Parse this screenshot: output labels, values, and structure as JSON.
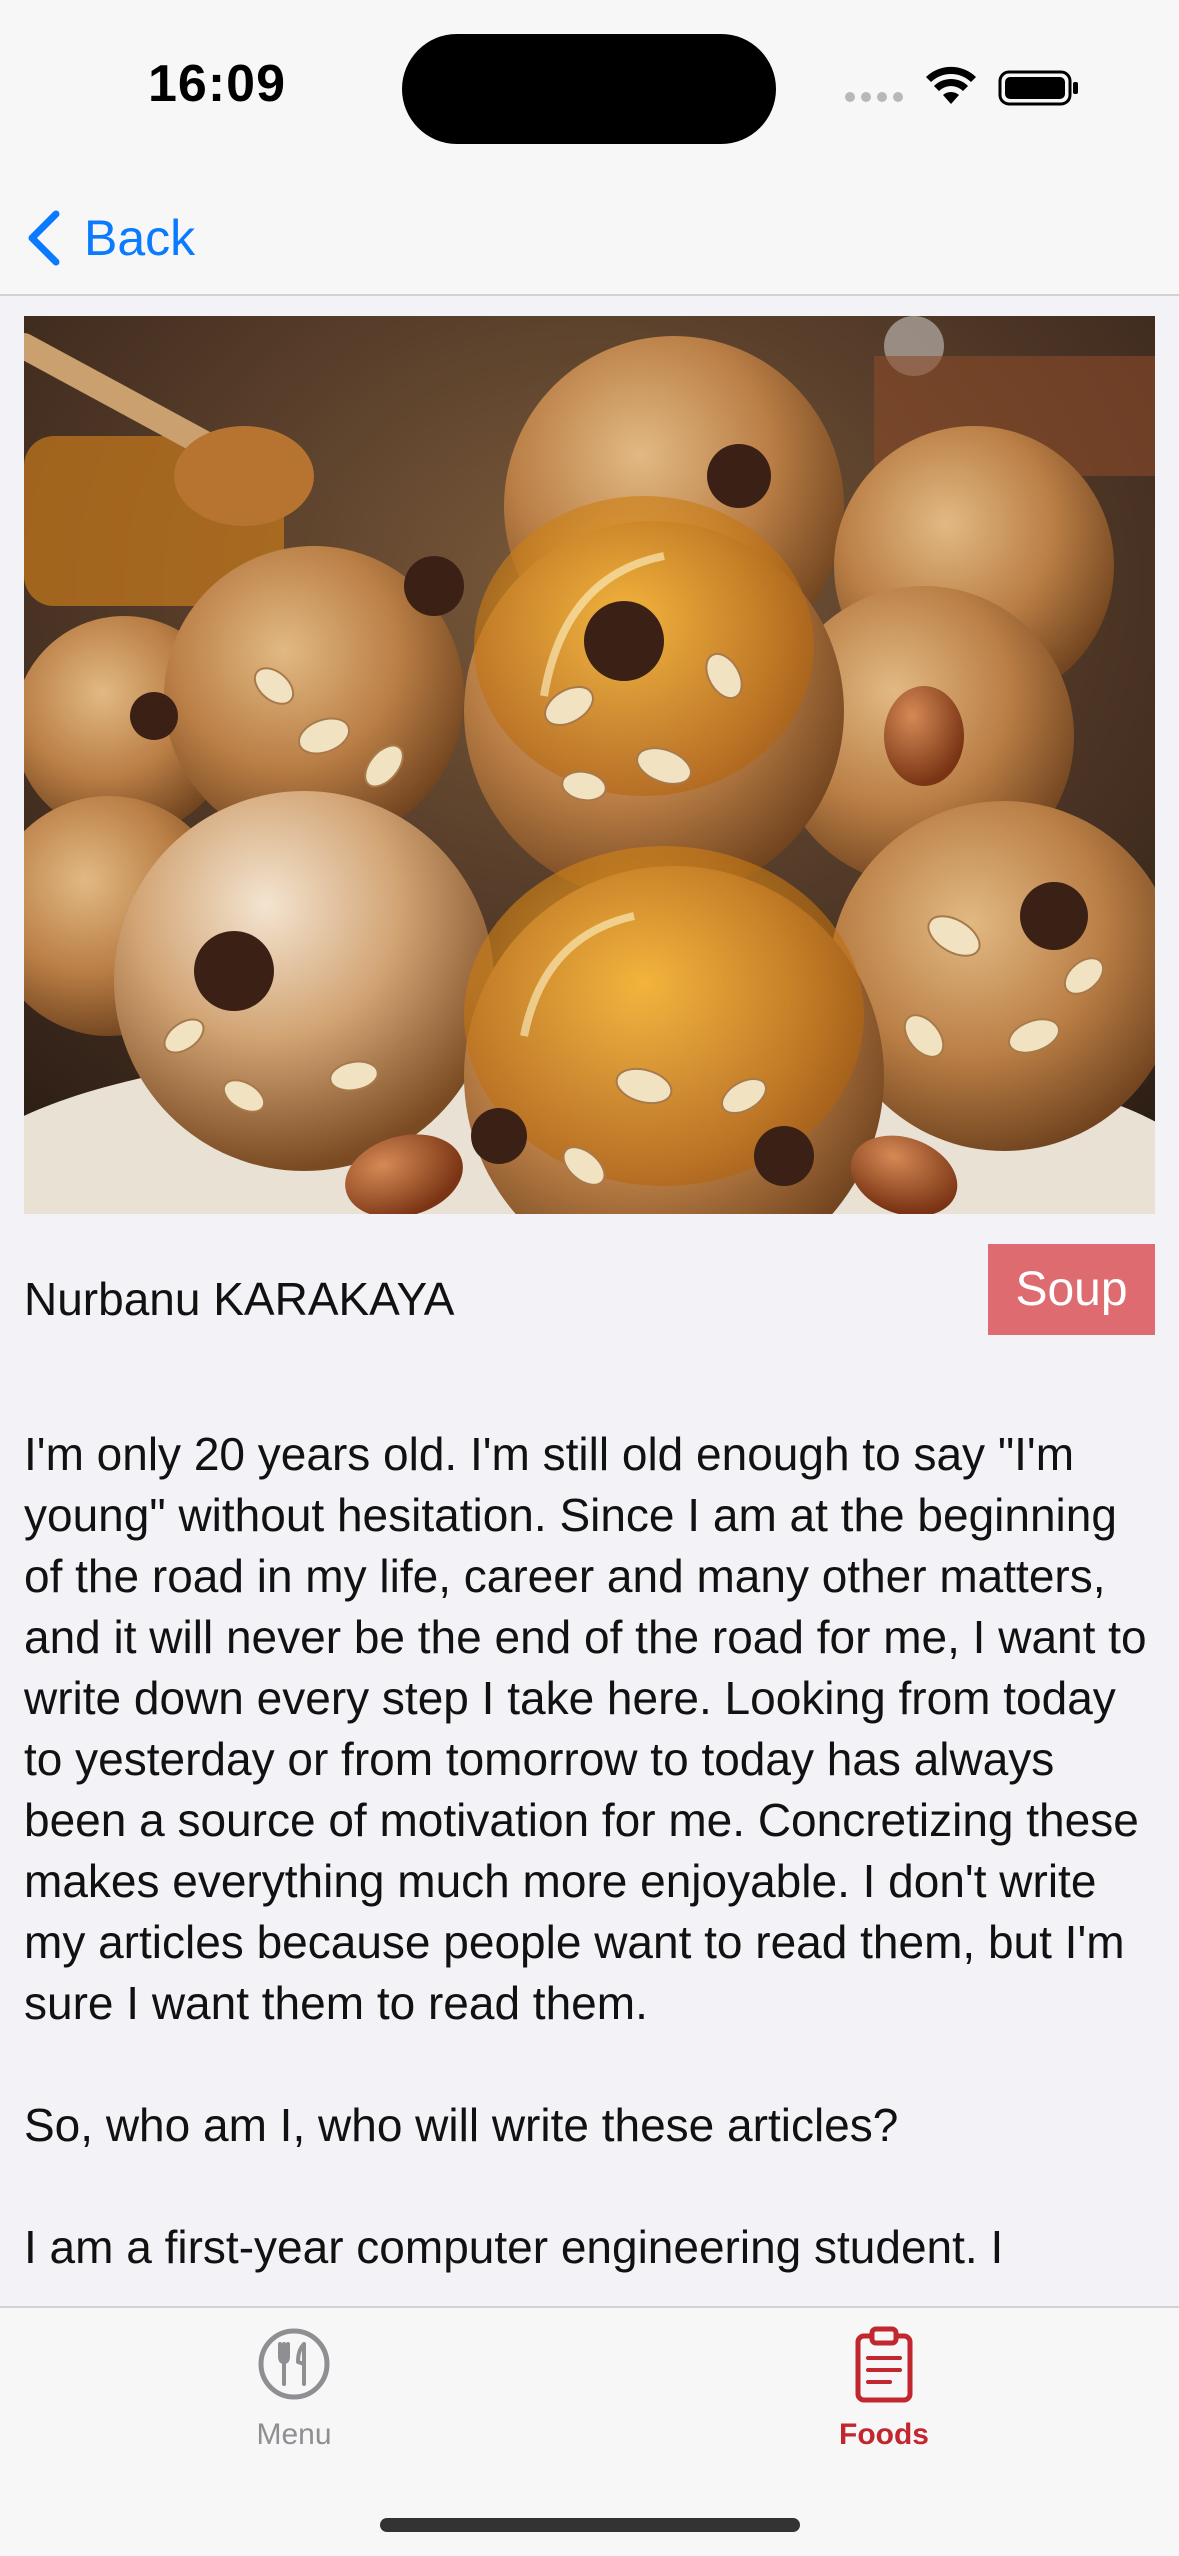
{
  "status_bar": {
    "time": "16:09"
  },
  "nav": {
    "back_label": "Back"
  },
  "post": {
    "author": "Nurbanu KARAKAYA",
    "category": "Soup",
    "paragraphs": [
      "I'm only 20 years old. I'm still old enough to say \"I'm young\" without hesitation. Since I am at the beginning of the road in my life, career and many other matters, and it will never be the end of the road for me, I want to write down every step I take here. Looking from today to yesterday or from tomorrow to today has always been a source of motivation for me. Concretizing these makes everything much more enjoyable. I don't write my articles because people want to read them, but I'm sure I want them to read them.",
      "So, who am I, who will write these articles?",
      "I am a first-year computer engineering student. I"
    ]
  },
  "tab_bar": {
    "items": [
      {
        "label": "Menu",
        "icon": "fork-knife-icon",
        "active": false
      },
      {
        "label": "Foods",
        "icon": "clipboard-list-icon",
        "active": true
      }
    ]
  },
  "colors": {
    "accent_blue": "#0a7aff",
    "badge_red": "#de6b70",
    "tab_active": "#c2262f",
    "tab_inactive": "#8e8e93"
  }
}
